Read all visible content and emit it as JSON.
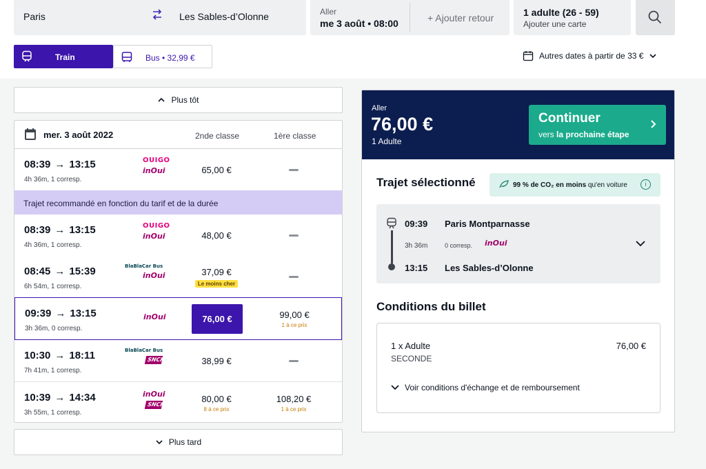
{
  "search": {
    "from": "Paris",
    "to": "Les Sables-d’Olonne",
    "outbound_label": "Aller",
    "outbound_value": "me 3 août • 08:00",
    "add_return": "+ Ajouter retour",
    "passengers": "1 adulte (26 - 59)",
    "add_card": "Ajouter une carte"
  },
  "modes": {
    "train_label": "Train",
    "bus_label": "Bus • 32,99 €"
  },
  "other_dates": "Autres dates à partir de 33 €",
  "results": {
    "earlier_label": "Plus tôt",
    "later_label": "Plus tard",
    "date": "mer. 3 août 2022",
    "col_second": "2nde classe",
    "col_first": "1ère classe",
    "recommended_text": "Trajet recommandé en fonction du tarif et de la durée",
    "rows": [
      {
        "dep": "08:39",
        "arr": "13:15",
        "meta": "4h 36m, 1 corresp.",
        "logo1": "OUIGO",
        "logo2": "inOui",
        "p2": "65,00 €",
        "p2_note": "",
        "p1": "",
        "p1_note": ""
      },
      {
        "dep": "08:39",
        "arr": "13:15",
        "meta": "4h 36m, 1 corresp.",
        "logo1": "OUIGO",
        "logo2": "inOui",
        "p2": "48,00 €",
        "p2_note": "",
        "p1": "",
        "p1_note": ""
      },
      {
        "dep": "08:45",
        "arr": "15:39",
        "meta": "6h 54m, 1 corresp.",
        "logo1": "BlaBlaCar Bus",
        "logo2": "inOui",
        "p2": "37,09 €",
        "p2_note": "Le moins cher",
        "p1": "",
        "p1_note": ""
      },
      {
        "dep": "09:39",
        "arr": "13:15",
        "meta": "3h 36m, 0 corresp.",
        "logo1": "",
        "logo2": "inOui",
        "p2": "76,00 €",
        "p2_note": "",
        "p1": "99,00 €",
        "p1_note": "1 à ce prix"
      },
      {
        "dep": "10:30",
        "arr": "18:11",
        "meta": "7h 41m, 1 corresp.",
        "logo1": "BlaBlaCar Bus",
        "logo2": "SNCF",
        "p2": "38,99 €",
        "p2_note": "",
        "p1": "",
        "p1_note": ""
      },
      {
        "dep": "10:39",
        "arr": "14:34",
        "meta": "3h 55m, 1 corresp.",
        "logo1": "inOui",
        "logo2": "SNCF",
        "p2": "80,00 €",
        "p2_note": "8 à ce prix",
        "p1": "108,20 €",
        "p1_note": "1 à ce prix"
      }
    ]
  },
  "summary": {
    "label": "Aller",
    "price": "76,00 €",
    "pax": "1 Adulte",
    "continue_title": "Continuer",
    "continue_sub_pre": "vers ",
    "continue_sub_bold": "la prochaine étape",
    "trip_title": "Trajet sélectionné",
    "co2_bold": "99 % de CO₂ en moins",
    "co2_rest": " qu'en voiture",
    "dep_time": "09:39",
    "dep_station": "Paris Montparnasse",
    "duration": "3h 36m",
    "corresp": "0 corresp.",
    "carrier": "inOui",
    "arr_time": "13:15",
    "arr_station": "Les Sables-d’Olonne",
    "conditions_title": "Conditions du billet",
    "ticket_pax": "1 x Adulte",
    "ticket_class": "SECONDE",
    "ticket_price": "76,00 €",
    "conditions_link": "Voir conditions d'échange et de remboursement"
  },
  "colors": {
    "brand": "#3c15ac",
    "navy": "#0c1d50",
    "cta": "#1bab8c",
    "recommended": "#d5ccf5"
  }
}
